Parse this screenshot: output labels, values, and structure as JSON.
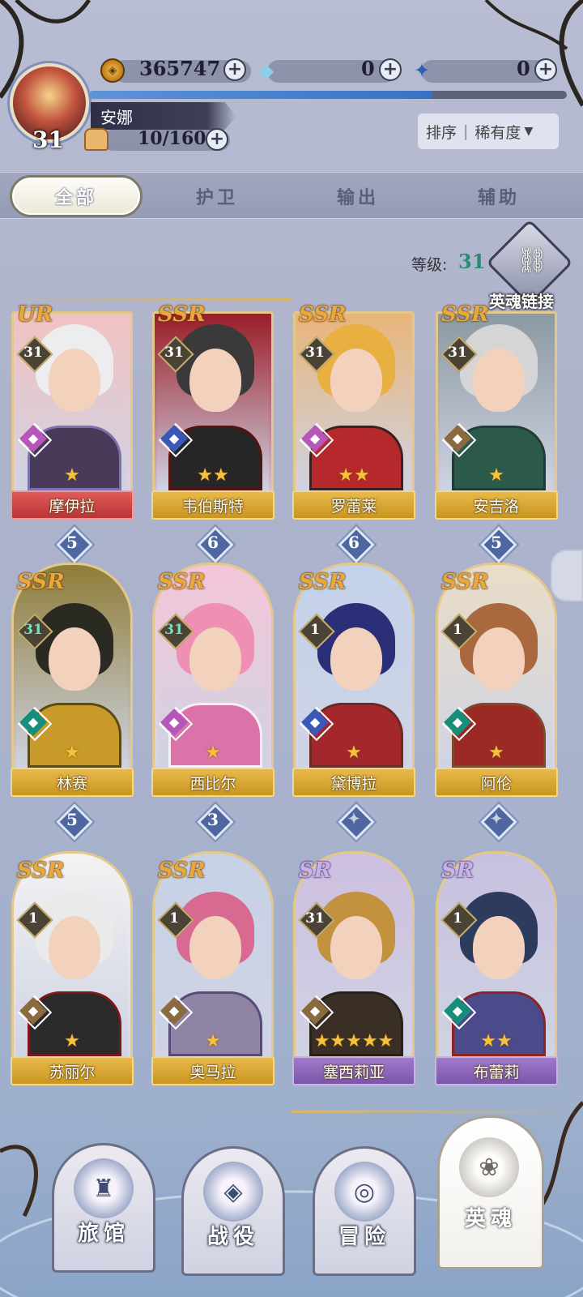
{
  "player": {
    "level": "31",
    "name": "安娜",
    "stamina": "10/160",
    "exp_progress": 0.72
  },
  "currencies": [
    {
      "icon": "gold-coin-icon",
      "value": "365747"
    },
    {
      "icon": "crystal-gem-icon",
      "value": "0"
    },
    {
      "icon": "blue-star-gem-icon",
      "value": "0"
    }
  ],
  "sort": {
    "label": "排序",
    "value": "稀有度",
    "arrow": "▼"
  },
  "tabs": [
    {
      "label": "全部",
      "active": true
    },
    {
      "label": "护卫",
      "active": false
    },
    {
      "label": "输出",
      "active": false
    },
    {
      "label": "辅助",
      "active": false
    }
  ],
  "level_filter": {
    "label": "等级:",
    "value": "31"
  },
  "soul_link": {
    "label": "英魂链接"
  },
  "heroes": [
    {
      "rarity": "UR",
      "level": "31",
      "class_icon": "mage-class-icon",
      "class_color": "#b656b8",
      "stars": "★",
      "name": "摩伊拉",
      "star_badge": "5",
      "banner": "red"
    },
    {
      "rarity": "SSR",
      "level": "31",
      "class_icon": "hat-class-icon",
      "class_color": "#3a58b8",
      "stars": "★★",
      "name": "韦伯斯特",
      "star_badge": "6",
      "banner": "gold"
    },
    {
      "rarity": "SSR",
      "level": "31",
      "class_icon": "mage-class-icon",
      "class_color": "#b656b8",
      "stars": "★★",
      "name": "罗蕾莱",
      "star_badge": "6",
      "banner": "gold"
    },
    {
      "rarity": "SSR",
      "level": "31",
      "class_icon": "shield-class-icon",
      "class_color": "#8a6a3e",
      "stars": "★",
      "name": "安吉洛",
      "star_badge": "5",
      "banner": "gold"
    },
    {
      "rarity": "SSR",
      "level": "31",
      "class_icon": "bow-class-icon",
      "class_color": "#178e7a",
      "stars": "★",
      "name": "林赛",
      "star_badge": "5",
      "banner": "gold"
    },
    {
      "rarity": "SSR",
      "level": "31",
      "class_icon": "mage-class-icon",
      "class_color": "#b656b8",
      "stars": "★",
      "name": "西比尔",
      "star_badge": "3",
      "banner": "gold"
    },
    {
      "rarity": "SSR",
      "level": "1",
      "class_icon": "hat-class-icon",
      "class_color": "#3a58b8",
      "stars": "★",
      "name": "黛博拉",
      "star_badge": "✦",
      "banner": "gold"
    },
    {
      "rarity": "SSR",
      "level": "1",
      "class_icon": "bow-class-icon",
      "class_color": "#178e7a",
      "stars": "★",
      "name": "阿伦",
      "star_badge": "✦",
      "banner": "gold"
    },
    {
      "rarity": "SSR",
      "level": "1",
      "class_icon": "heal-class-icon",
      "class_color": "#8a6a3e",
      "stars": "★",
      "name": "苏丽尔",
      "star_badge": "",
      "banner": "gold"
    },
    {
      "rarity": "SSR",
      "level": "1",
      "class_icon": "shield-class-icon",
      "class_color": "#8a6a3e",
      "stars": "★",
      "name": "奥马拉",
      "star_badge": "",
      "banner": "gold"
    },
    {
      "rarity": "SR",
      "level": "31",
      "class_icon": "heal-class-icon",
      "class_color": "#8a6a3e",
      "stars": "★★★★★",
      "name": "塞西莉亚",
      "star_badge": "",
      "banner": "purple"
    },
    {
      "rarity": "SR",
      "level": "1",
      "class_icon": "bow-class-icon",
      "class_color": "#178e7a",
      "stars": "★★",
      "name": "布蕾莉",
      "star_badge": "",
      "banner": "purple"
    }
  ],
  "nav": [
    {
      "label": "旅馆",
      "icon": "tavern-icon",
      "active": false
    },
    {
      "label": "战役",
      "icon": "campaign-icon",
      "active": false
    },
    {
      "label": "冒险",
      "icon": "adventure-icon",
      "active": false
    },
    {
      "label": "英魂",
      "icon": "hero-soul-icon",
      "active": true
    }
  ]
}
